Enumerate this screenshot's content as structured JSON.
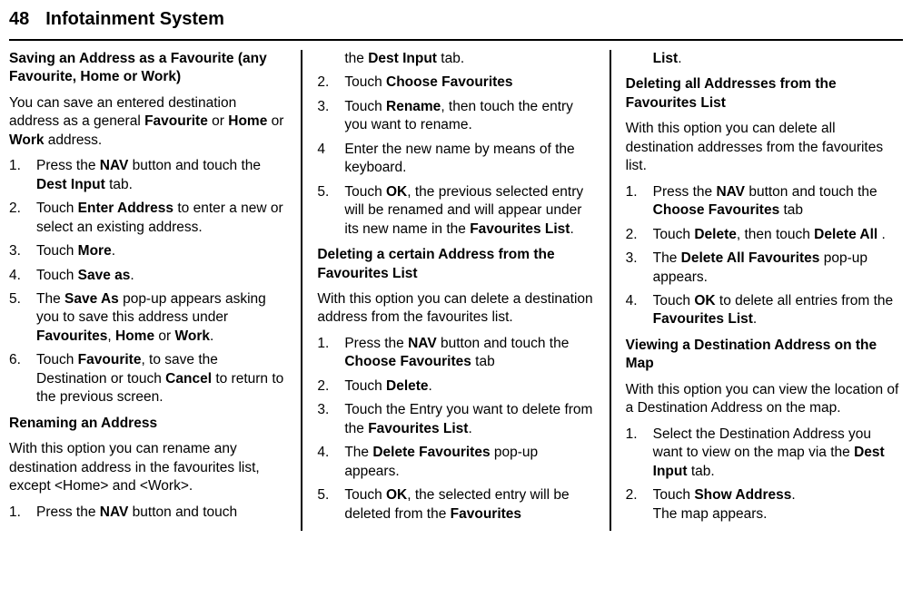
{
  "header": {
    "page_number": "48",
    "title": "Infotainment System"
  },
  "col1": {
    "h_save_addr": "Saving an Address as a Favourite (any Favourite, Home or Work)",
    "p_save_intro_1": "You can save an entered destination address as a general ",
    "b_favourite": "Favourite",
    "p_save_intro_2": " or ",
    "b_home": "Home",
    "p_save_intro_3": " or ",
    "b_work": "Work",
    "p_save_intro_4": " address.",
    "s1": {
      "n": "1.",
      "t1": "Press the ",
      "b_nav": "NAV",
      "t2": " button and touch the ",
      "b_dest": "Dest Input",
      "t3": " tab."
    },
    "s2": {
      "n": "2.",
      "t1": "Touch ",
      "b_enter": "Enter Address",
      "t2": " to enter a new or select an existing address."
    },
    "s3": {
      "n": "3.",
      "t1": "Touch ",
      "b_more": "More",
      "t2": "."
    },
    "s4": {
      "n": "4.",
      "t1": "Touch ",
      "b_saveas": "Save as",
      "t2": "."
    },
    "s5": {
      "n": "5.",
      "t1": "The ",
      "b_saveas2": "Save As",
      "t2": " pop-up appears asking you to save this address under ",
      "b_fav": "Favourites",
      "t3": ", ",
      "b_home2": "Home",
      "t4": " or ",
      "b_work2": "Work",
      "t5": "."
    },
    "s6": {
      "n": "6.",
      "t1": "Touch ",
      "b_fav2": "Favourite",
      "t2": ", to save the Destination or touch ",
      "b_cancel": "Cancel",
      "t3": " to return to the previous screen."
    },
    "h_rename": "Renaming an Address",
    "p_rename_intro": "With this option you can rename any destination address in the favourites list, except <Home> and <Work>.",
    "r1": {
      "n": "1.",
      "t1": "Press the ",
      "b_nav": "NAV",
      "t2": " button and touch"
    }
  },
  "col2": {
    "cont_t1": "the ",
    "cont_b": "Dest Input",
    "cont_t2": " tab.",
    "s2": {
      "n": "2.",
      "t1": "Touch ",
      "b_cf": "Choose Favourites"
    },
    "s3": {
      "n": "3.",
      "t1": "Touch ",
      "b_ren": "Rename",
      "t2": ", then touch the entry you want to rename."
    },
    "s4": {
      "n": "4",
      "t1": "Enter the new name by means of the keyboard."
    },
    "s5": {
      "n": "5.",
      "t1": "Touch ",
      "b_ok": "OK",
      "t2": ", the previous selected entry will be renamed and will appear under its new name in the ",
      "b_fl": "Favourites List",
      "t3": "."
    },
    "h_del_one": "Deleting a certain Address from the Favourites List",
    "p_del_intro": "With this option you can delete a destination address from the favourites list.",
    "d1": {
      "n": "1.",
      "t1": "Press the ",
      "b_nav": "NAV",
      "t2": " button and touch the ",
      "b_cf": "Choose Favourites",
      "t3": " tab"
    },
    "d2": {
      "n": "2.",
      "t1": "Touch ",
      "b_del": "Delete",
      "t2": "."
    },
    "d3": {
      "n": "3.",
      "t1": "Touch the Entry you want to delete from the ",
      "b_fl": "Favourites List",
      "t2": "."
    },
    "d4": {
      "n": "4.",
      "t1": "The ",
      "b_df": "Delete Favourites",
      "t2": " pop-up appears."
    },
    "d5": {
      "n": "5.",
      "t1": "Touch ",
      "b_ok": "OK",
      "t2": ", the selected entry will be deleted from the ",
      "b_fav": "Favourites"
    }
  },
  "col3": {
    "cont_b": "List",
    "cont_t": ".",
    "h_del_all": "Deleting all Addresses from the Favourites List",
    "p_del_all_intro": "With this option you can delete all destination addresses from the favourites list.",
    "a1": {
      "n": "1.",
      "t1": "Press the ",
      "b_nav": "NAV",
      "t2": " button and touch the ",
      "b_cf": "Choose Favourites",
      "t3": " tab"
    },
    "a2": {
      "n": "2.",
      "t1": "Touch ",
      "b_del": "Delete",
      "t2": ", then touch ",
      "b_da": "Delete All",
      "t3": " ."
    },
    "a3": {
      "n": "3.",
      "t1": "The ",
      "b_daf": "Delete All Favourites",
      "t2": " pop-up appears."
    },
    "a4": {
      "n": "4.",
      "t1": "Touch ",
      "b_ok": "OK",
      "t2": " to delete all entries from the ",
      "b_fl": "Favourites List",
      "t3": "."
    },
    "h_view": "Viewing a Destination Address on the Map",
    "p_view_intro": "With this option you can view the location of a Destination Address on the map.",
    "v1": {
      "n": "1.",
      "t1": "Select the Destination Address you want to view on the map via the ",
      "b_di": "Dest Input",
      "t2": " tab."
    },
    "v2": {
      "n": "2.",
      "t1": "Touch ",
      "b_sa": "Show Address",
      "t2": ".",
      "t3": "The map appears."
    }
  }
}
